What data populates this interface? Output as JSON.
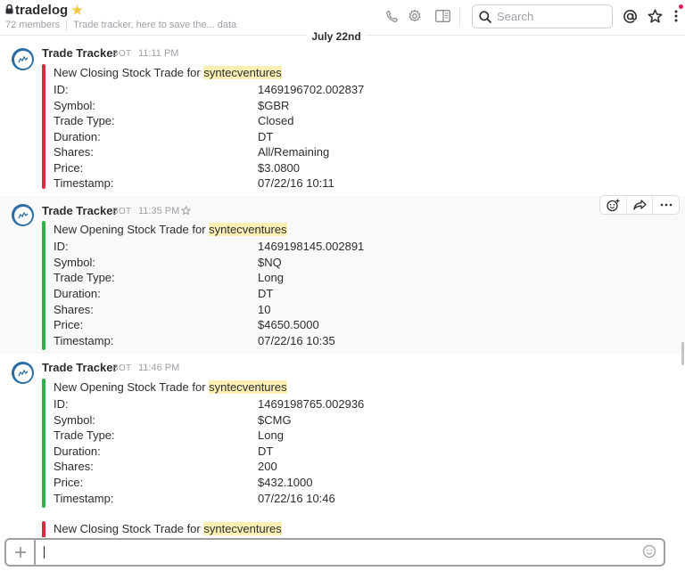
{
  "channel": {
    "name": "tradelog",
    "members": "72 members",
    "topic": "Trade tracker, here to save the... data"
  },
  "search": {
    "placeholder": "Search"
  },
  "date_divider": "July 22nd",
  "messages": [
    {
      "author": "Trade Tracker",
      "bot_badge": "BOT",
      "time": "11:11 PM",
      "bar_color": "#d72b3f",
      "title_prefix": "New Closing Stock Trade for ",
      "title_user": "syntecventures",
      "rows": [
        {
          "label": "ID:",
          "value": "1469196702.002837"
        },
        {
          "label": "Symbol:",
          "value": "$GBR"
        },
        {
          "label": "Trade Type:",
          "value": "Closed"
        },
        {
          "label": "Duration:",
          "value": "DT"
        },
        {
          "label": "Shares:",
          "value": "All/Remaining"
        },
        {
          "label": "Price:",
          "value": "$3.0800"
        },
        {
          "label": "Timestamp:",
          "value": "07/22/16 10:11"
        }
      ]
    },
    {
      "author": "Trade Tracker",
      "bot_badge": "BOT",
      "time": "11:35 PM",
      "bar_color": "#2fb14a",
      "title_prefix": "New Opening Stock Trade for ",
      "title_user": "syntecventures",
      "rows": [
        {
          "label": "ID:",
          "value": "1469198145.002891"
        },
        {
          "label": "Symbol:",
          "value": "$NQ"
        },
        {
          "label": "Trade Type:",
          "value": "Long"
        },
        {
          "label": "Duration:",
          "value": "DT"
        },
        {
          "label": "Shares:",
          "value": "10"
        },
        {
          "label": "Price:",
          "value": "$4650.5000"
        },
        {
          "label": "Timestamp:",
          "value": "07/22/16 10:35"
        }
      ]
    },
    {
      "author": "Trade Tracker",
      "bot_badge": "BOT",
      "time": "11:46 PM",
      "bar_color": "#2fb14a",
      "title_prefix": "New Opening Stock Trade for ",
      "title_user": "syntecventures",
      "rows": [
        {
          "label": "ID:",
          "value": "1469198765.002936"
        },
        {
          "label": "Symbol:",
          "value": "$CMG"
        },
        {
          "label": "Trade Type:",
          "value": "Long"
        },
        {
          "label": "Duration:",
          "value": "DT"
        },
        {
          "label": "Shares:",
          "value": "200"
        },
        {
          "label": "Price:",
          "value": "$432.1000"
        },
        {
          "label": "Timestamp:",
          "value": "07/22/16 10:46"
        }
      ]
    },
    {
      "bar_color": "#d72b3f",
      "title_prefix": "New Closing Stock Trade for ",
      "title_user": "syntecventures"
    }
  ],
  "colors": {
    "highlight": "#fcefb4",
    "star": "#f2c744",
    "avatar": "#2b6ca3",
    "notification_dot": "#e01e5a"
  },
  "icons": {
    "header": [
      "phone-icon",
      "gear-icon",
      "sidebar-toggle-icon",
      "at-mention-icon",
      "star-icon",
      "kebab-menu-icon"
    ],
    "hover_actions": [
      "add-reaction-icon",
      "share-icon",
      "more-icon"
    ],
    "composer": [
      "plus-icon",
      "emoji-icon"
    ]
  }
}
